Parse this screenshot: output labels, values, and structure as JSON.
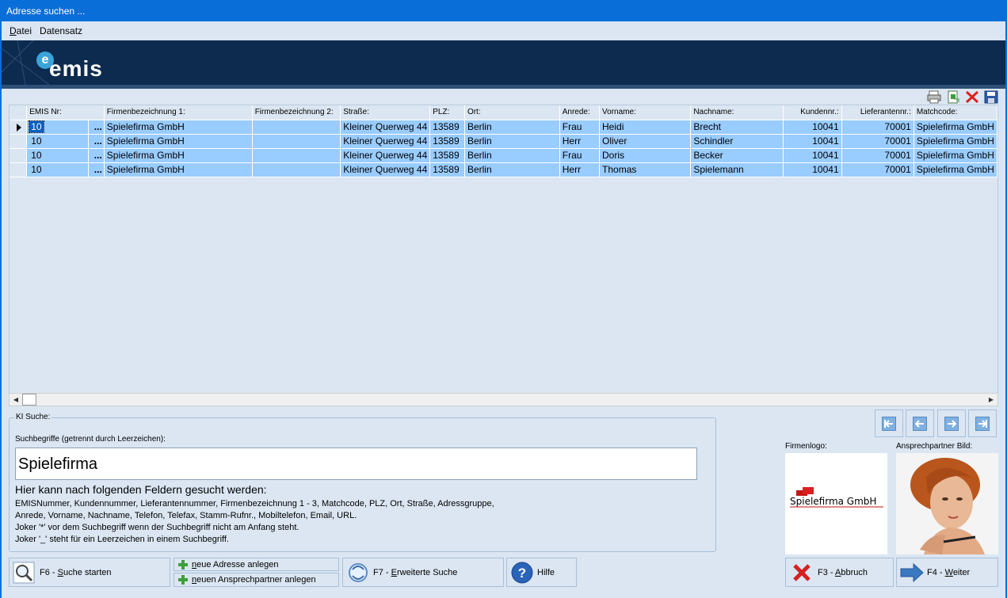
{
  "window": {
    "title": "Adresse suchen ..."
  },
  "menu": {
    "items": [
      {
        "underline": "D",
        "rest": "atei"
      },
      {
        "underline": "",
        "rest": "Datensatz"
      }
    ]
  },
  "banner": {
    "logo_text": "emis",
    "logo_mark": "e"
  },
  "toolbar": {
    "icons": [
      "print-icon",
      "export-icon",
      "delete-icon",
      "save-icon"
    ]
  },
  "grid": {
    "columns": [
      "EMIS Nr:",
      "Firmenbezeichnung 1:",
      "Firmenbezeichnung 2:",
      "Straße:",
      "PLZ:",
      "Ort:",
      "Anrede:",
      "Vorname:",
      "Nachname:",
      "Kundennr.:",
      "Lieferantennr.:",
      "Matchcode:"
    ],
    "ellipsis": "...",
    "rows": [
      {
        "emis": "10",
        "firma1": "Spielefirma GmbH",
        "firma2": "",
        "strasse": "Kleiner Querweg 44",
        "plz": "13589",
        "ort": "Berlin",
        "anrede": "Frau",
        "vorname": "Heidi",
        "nachname": "Brecht",
        "kundennr": "10041",
        "lieferantennr": "70001",
        "matchcode": "Spielefirma GmbH"
      },
      {
        "emis": "10",
        "firma1": "Spielefirma GmbH",
        "firma2": "",
        "strasse": "Kleiner Querweg 44",
        "plz": "13589",
        "ort": "Berlin",
        "anrede": "Herr",
        "vorname": "Oliver",
        "nachname": "Schindler",
        "kundennr": "10041",
        "lieferantennr": "70001",
        "matchcode": "Spielefirma GmbH"
      },
      {
        "emis": "10",
        "firma1": "Spielefirma GmbH",
        "firma2": "",
        "strasse": "Kleiner Querweg 44",
        "plz": "13589",
        "ort": "Berlin",
        "anrede": "Frau",
        "vorname": "Doris",
        "nachname": "Becker",
        "kundennr": "10041",
        "lieferantennr": "70001",
        "matchcode": "Spielefirma GmbH"
      },
      {
        "emis": "10",
        "firma1": "Spielefirma GmbH",
        "firma2": "",
        "strasse": "Kleiner Querweg 44",
        "plz": "13589",
        "ort": "Berlin",
        "anrede": "Herr",
        "vorname": "Thomas",
        "nachname": "Spielemann",
        "kundennr": "10041",
        "lieferantennr": "70001",
        "matchcode": "Spielefirma GmbH"
      }
    ]
  },
  "ki_suche": {
    "legend": "KI Suche:",
    "label": "Suchbegriffe (getrennt durch Leerzeichen):",
    "value": "Spielefirma",
    "help_title": "Hier kann nach folgenden Feldern gesucht werden:",
    "help_lines": [
      "EMISNummer, Kundennummer, Lieferantennummer, Firmenbezeichnung 1 - 3, Matchcode, PLZ, Ort, Straße, Adressgruppe,",
      "Anrede, Vorname, Nachname, Telefon, Telefax, Stamm-Rufnr., Mobiltelefon, Email, URL.",
      "Joker '*' vor dem Suchbegriff wenn der Suchbegriff nicht am Anfang steht.",
      "Joker '_' steht für ein Leerzeichen in einem Suchbegriff."
    ]
  },
  "images": {
    "firmenlogo_label": "Firmenlogo:",
    "firmenlogo_text": "Spielefirma GmbH",
    "ansprechpartner_label": "Ansprechpartner Bild:"
  },
  "buttons": {
    "suche_starten": {
      "prefix": "F6 - ",
      "underline": "S",
      "rest": "uche starten"
    },
    "neue_adresse": {
      "underline": "n",
      "rest": "eue Adresse anlegen"
    },
    "neuer_ansprechpartner": {
      "underline": "n",
      "rest": "euen Ansprechpartner anlegen"
    },
    "erweiterte_suche": {
      "prefix": "F7 - ",
      "underline": "E",
      "rest": "rweiterte Suche"
    },
    "hilfe": {
      "label": "Hilfe"
    },
    "abbruch": {
      "prefix": "F3 - ",
      "underline": "A",
      "rest": "bbruch"
    },
    "weiter": {
      "prefix": "F4 - ",
      "underline": "W",
      "rest": "eiter"
    }
  }
}
